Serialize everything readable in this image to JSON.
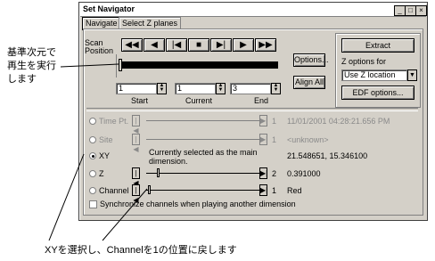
{
  "window": {
    "title": "Set Navigator",
    "controls": {
      "minimize": "_",
      "maximize": "□",
      "close": "×"
    }
  },
  "tabs": [
    {
      "label": "Navigate",
      "active": true
    },
    {
      "label": "Select Z planes",
      "active": false
    }
  ],
  "scan": {
    "label_line1": "Scan",
    "label_line2": "Position",
    "transport_icons": [
      "rewind-icon",
      "step-back-icon",
      "skip-start-icon",
      "stop-icon",
      "skip-end-icon",
      "play-icon",
      "fast-forward-icon"
    ],
    "transport_glyphs": [
      "◀◀",
      "◀",
      "|◀",
      "■",
      "▶|",
      "▶",
      "▶▶"
    ],
    "options_button": "Options...",
    "align_all_button": "Align All",
    "start_value": "1",
    "current_value": "1",
    "end_value": "3",
    "start_label": "Start",
    "current_label": "Current",
    "end_label": "End"
  },
  "right_panel": {
    "extract_button": "Extract",
    "z_options_label": "Z options for",
    "z_select_value": "Use Z location",
    "edf_button": "EDF options..."
  },
  "dimensions": [
    {
      "name": "Time Pt.",
      "enabled": false,
      "selected": false,
      "value": "1",
      "readout": "11/01/2001 04:28:21.656 PM"
    },
    {
      "name": "Site",
      "enabled": false,
      "selected": false,
      "value": "1",
      "readout": "<unknown>"
    },
    {
      "name": "XY",
      "enabled": true,
      "selected": true,
      "value": "",
      "readout": "21.548651, 15.346100",
      "note": "Currently selected as the main dimension."
    },
    {
      "name": "Z",
      "enabled": true,
      "selected": false,
      "value": "2",
      "readout": "0.391000"
    },
    {
      "name": "Channel",
      "enabled": true,
      "selected": false,
      "value": "1",
      "readout": "Red"
    }
  ],
  "sync_checkbox": {
    "label": "Synchronize channels when playing another dimension",
    "checked": false
  },
  "annotations": {
    "left_line1": "基準次元で",
    "left_line2": "再生を実行",
    "left_line3": "します",
    "bottom": "XYを選択し、Channelを1の位置に戻します"
  },
  "colors": {
    "window_bg": "#d4d0c8",
    "disabled_text": "#8a8a8a"
  }
}
